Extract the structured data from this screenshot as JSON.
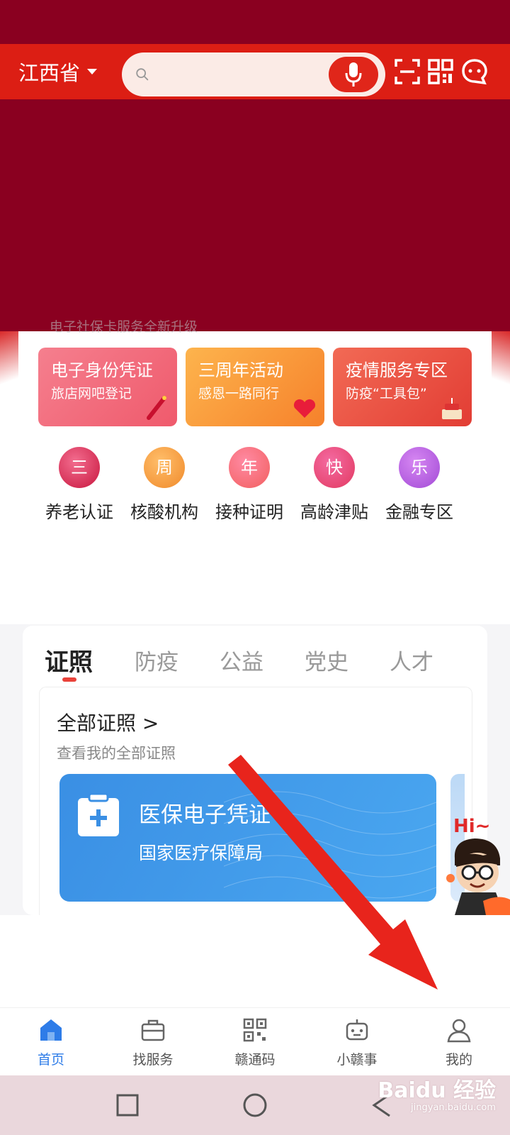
{
  "header": {
    "province": "江西省",
    "search_placeholder": "",
    "mic_icon": "microphone-icon",
    "scan_icon": "scan-icon",
    "qr_icon": "qr-code-icon",
    "chat_icon": "message-icon",
    "brand_color": "#dc1e14"
  },
  "quick": {
    "faded_text": "电子社保卡服务全新升级",
    "promos": [
      {
        "title": "电子身份凭证",
        "subtitle": "旅店网吧登记"
      },
      {
        "title": "三周年活动",
        "subtitle": "感恩一路同行"
      },
      {
        "title": "疫情服务专区",
        "subtitle": "防疫“工具包”"
      }
    ],
    "items": [
      {
        "char": "三",
        "label": "养老认证"
      },
      {
        "char": "周",
        "label": "核酸机构"
      },
      {
        "char": "年",
        "label": "接种证明"
      },
      {
        "char": "快",
        "label": "高龄津贴"
      },
      {
        "char": "乐",
        "label": "金融专区"
      }
    ]
  },
  "tabs": [
    "证照",
    "防疫",
    "公益",
    "党史",
    "人才"
  ],
  "certificates": {
    "title": "全部证照 >",
    "subtitle": "查看我的全部证照",
    "card_title": "医保电子凭证",
    "card_subtitle": "国家医疗保障局"
  },
  "mascot": {
    "greeting": "Hi~"
  },
  "bottom_nav": [
    {
      "label": "首页",
      "icon": "home-icon",
      "active": true
    },
    {
      "label": "找服务",
      "icon": "briefcase-icon",
      "active": false
    },
    {
      "label": "赣通码",
      "icon": "qr-code-icon",
      "active": false
    },
    {
      "label": "小赣事",
      "icon": "robot-icon",
      "active": false
    },
    {
      "label": "我的",
      "icon": "user-icon",
      "active": false
    }
  ],
  "watermark": {
    "main": "Baidu 经验",
    "sub": "jingyan.baidu.com"
  },
  "colors": {
    "accent_blue": "#2e7ce8",
    "dark_red": "#8a0020",
    "arrow_red": "#e8241c"
  }
}
